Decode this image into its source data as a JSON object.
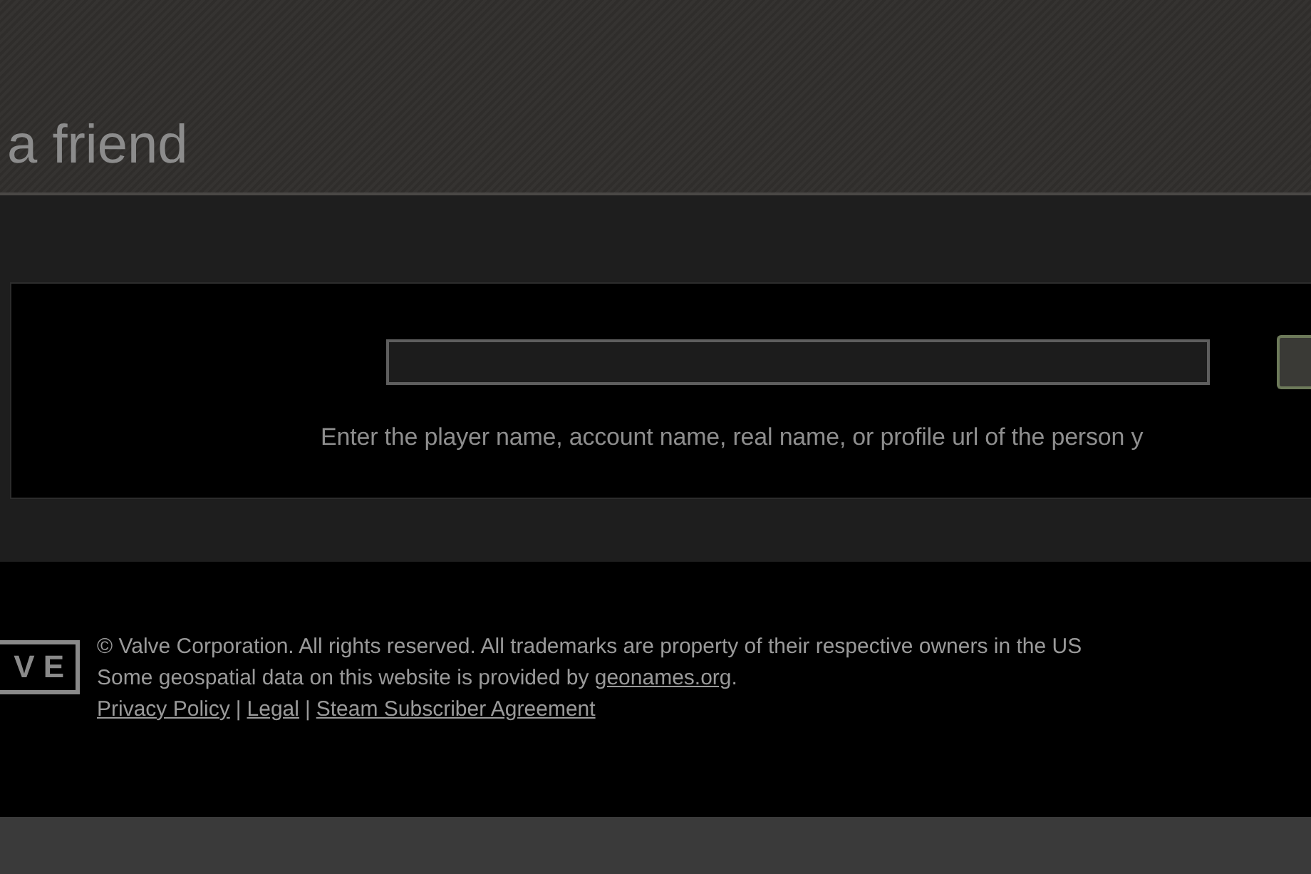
{
  "page_title": "a friend",
  "search": {
    "hint": "Enter the player name, account name, real name, or profile url of the person y"
  },
  "footer": {
    "logo": "VE",
    "copyright": "© Valve Corporation. All rights reserved. All trademarks are property of their respective owners in the US",
    "geo_text": "Some geospatial data on this website is provided by",
    "geo_link": "geonames.org",
    "geo_end": ".",
    "separator": "|",
    "links": [
      "Privacy Policy",
      "Legal",
      "Steam Subscriber Agreement"
    ]
  }
}
